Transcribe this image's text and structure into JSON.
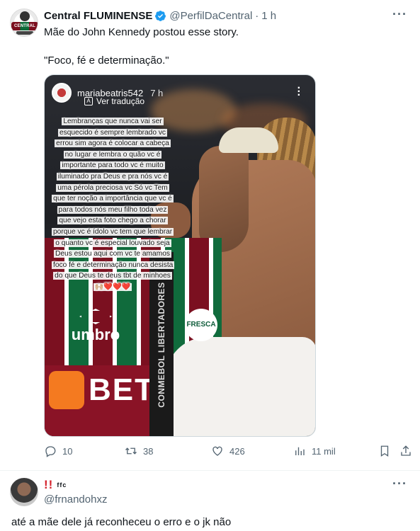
{
  "tweet": {
    "author_name": "Central FLUMINENSE",
    "handle": "@PerfilDaCentral",
    "separator": "·",
    "time": "1 h",
    "avatar_text": "CENTRAL",
    "text_line1": "Mãe do John Kennedy postou esse story.",
    "text_line2": "\"Foco, fé e determinação.\"",
    "verified": true
  },
  "story": {
    "username": "mariabeatris542",
    "time": "7 h",
    "translate_label": "Ver tradução",
    "overlay_text": "Lembranças que nunca vai ser esquecido é sempre lembrado vc errou sim agora é colocar a cabeça no lugar e lembra o quão vc é importante para todo vc é muito iluminado pra Deus e pra nós vc é uma pérola preciosa vc  Só vc  Tem que ter noção a importância que  vc é para todos nós meu filho toda vez que vejo esta foto chego a chorar porque vc é ídolo vc tem que lembrar o quanto vc é especial louvado seja Deus estou aqui com vc te amamos foco fé e determinação nunca desista do que Deus te deus tbt de minhoes 🙌🏼❤️❤️❤️",
    "lanyard_text": "CONMEBOL LIBERTADORES",
    "jersey_brand": "umbro",
    "sponsor_text": "BET",
    "patch_text": "FRESCA"
  },
  "actions": {
    "replies": "10",
    "retweets": "38",
    "likes": "426",
    "views": "11 mil"
  },
  "reply": {
    "name_exclaim": "!!",
    "name_small": "ffc",
    "handle": "@frnandohxz",
    "text": "até a mãe dele já reconheceu o erro e o jk não"
  },
  "colors": {
    "verified_blue": "#1d9bf0",
    "secondary_text": "#536471",
    "primary_text": "#0f1419",
    "exclaim_red": "#d4212b"
  },
  "icons": [
    "verified-badge-icon",
    "more-icon",
    "translate-icon",
    "reply-icon",
    "retweet-icon",
    "like-icon",
    "views-icon",
    "bookmark-icon",
    "share-icon"
  ]
}
